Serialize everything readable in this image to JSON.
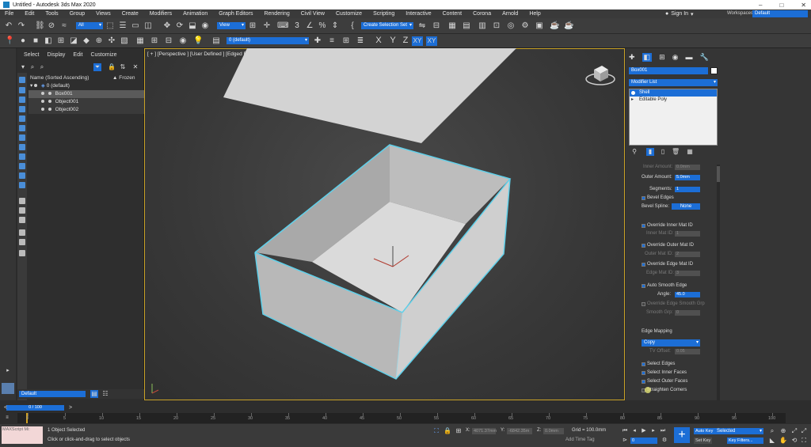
{
  "titlebar": {
    "title": "Untitled - Autodesk 3ds Max 2020",
    "minimize": "–",
    "maximize": "□",
    "close": "✕"
  },
  "menu": [
    "File",
    "Edit",
    "Tools",
    "Group",
    "Views",
    "Create",
    "Modifiers",
    "Animation",
    "Graph Editors",
    "Rendering",
    "Civil View",
    "Customize",
    "Scripting",
    "Interactive",
    "Content",
    "Corona",
    "Arnold",
    "Help"
  ],
  "signin": "Sign In",
  "workspace": {
    "label": "Workspaces:",
    "value": "Default"
  },
  "toolbar": {
    "selection_filter": "All",
    "ref_coord": "View",
    "named_selection": "Create Selection Set",
    "layer_dropdown": "0 (default)",
    "axis": [
      "X",
      "Y",
      "Z",
      "XY",
      "XY"
    ]
  },
  "scene_explorer": {
    "tabs": [
      "Select",
      "Display",
      "Edit",
      "Customize"
    ],
    "header_name": "Name (Sorted Ascending)",
    "header_frozen": "▲ Frozen",
    "rows": [
      {
        "name": "0 (default)",
        "indent": 0,
        "selected": false,
        "layer": true
      },
      {
        "name": "Box001",
        "indent": 1,
        "selected": true,
        "layer": false
      },
      {
        "name": "Object001",
        "indent": 1,
        "selected": false,
        "layer": false
      },
      {
        "name": "Object002",
        "indent": 1,
        "selected": false,
        "layer": false
      }
    ],
    "layer_dropdown": "Default"
  },
  "viewport": {
    "label": "[ + ] [Perspective ] [User Defined ] [Edged Faces ]"
  },
  "command_panel": {
    "object_name": "Box001",
    "modifier_list": "Modifier List",
    "stack": [
      {
        "label": "Shell",
        "selected": true
      },
      {
        "label": "Editable Poly",
        "selected": false
      }
    ],
    "params": {
      "inner_amount_label": "Inner Amount:",
      "inner_amount": "0.0mm",
      "outer_amount_label": "Outer Amount:",
      "outer_amount": "5.0mm",
      "segments_label": "Segments:",
      "segments": "1",
      "bevel_edges": "Bevel Edges",
      "bevel_spline_label": "Bevel Spline:",
      "bevel_spline_btn": "None",
      "override_inner": "Override Inner Mat ID",
      "inner_mat_label": "Inner Mat ID:",
      "inner_mat": "1",
      "override_outer": "Override Outer Mat ID",
      "outer_mat_label": "Outer Mat ID:",
      "outer_mat": "2",
      "override_edge": "Override Edge Mat ID",
      "edge_mat_label": "Edge Mat ID:",
      "edge_mat": "3",
      "auto_smooth": "Auto Smooth Edge",
      "angle_label": "Angle:",
      "angle": "45.0",
      "override_smooth": "Override Edge Smooth Grp",
      "smooth_grp_label": "Smooth Grp:",
      "smooth_grp": "0",
      "edge_mapping_label": "Edge Mapping",
      "edge_mapping": "Copy",
      "tv_offset_label": "TV Offset:",
      "tv_offset": "0.05",
      "select_edges": "Select Edges",
      "select_inner": "Select Inner Faces",
      "select_outer": "Select Outer Faces",
      "straighten": "Straighten Corners"
    }
  },
  "timeline": {
    "slider": "0 / 100",
    "ticks": [
      "0",
      "5",
      "10",
      "15",
      "20",
      "25",
      "30",
      "35",
      "40",
      "45",
      "50",
      "55",
      "60",
      "65",
      "70",
      "75",
      "80",
      "85",
      "90",
      "95",
      "100"
    ]
  },
  "status": {
    "maxscript": "MAXScript Mi:",
    "selected": "1 Object Selected",
    "prompt": "Click or click-and-drag to select objects",
    "x_label": "X:",
    "x": "4071.37mm",
    "y_label": "Y:",
    "y": "-6842.35m",
    "z_label": "Z:",
    "z": "0.0mm",
    "grid": "Grid = 100.0mm",
    "add_time_tag": "Add Time Tag",
    "auto_key": "Auto Key",
    "selected_dd": "Selected",
    "set_key": "Set Key",
    "key_filters": "Key Filters...",
    "frame": "0"
  }
}
